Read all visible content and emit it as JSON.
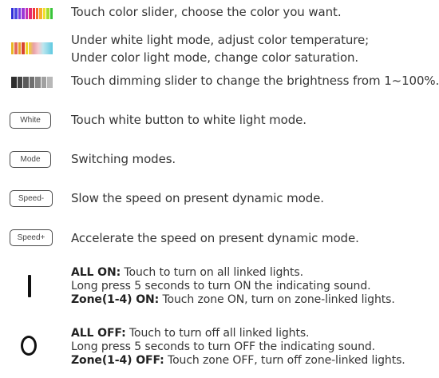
{
  "rows": [
    {
      "icon": "color-slider-icon",
      "text": "Touch color slider, choose the color you want."
    },
    {
      "icon": "saturation-slider-icon",
      "lines": [
        "Under white light mode, adjust color temperature;",
        "Under color light mode, change color saturation."
      ]
    },
    {
      "icon": "dimming-slider-icon",
      "text": "Touch dimming slider to change the brightness from 1~100%."
    },
    {
      "icon": "white-button-icon",
      "button": "White",
      "text": "Touch white button to white light mode."
    },
    {
      "icon": "mode-button-icon",
      "button": "Mode",
      "text": "Switching modes."
    },
    {
      "icon": "speed-minus-button-icon",
      "button": "Speed-",
      "text": "Slow the speed on present dynamic mode."
    },
    {
      "icon": "speed-plus-button-icon",
      "button": "Speed+",
      "text": "Accelerate the speed on present dynamic mode."
    },
    {
      "icon": "power-on-icon",
      "line1_bold": "ALL ON:",
      "line1": " Touch to turn on all linked lights.",
      "line2": "Long press 5 seconds to turn ON the indicating sound.",
      "line3_bold": "Zone(1-4) ON:",
      "line3": " Touch zone ON, turn on zone-linked lights."
    },
    {
      "icon": "power-off-icon",
      "line1_bold": "ALL OFF:",
      "line1": " Touch to turn off all linked lights.",
      "line2": "Long press 5 seconds to turn OFF the indicating sound.",
      "line3_bold": "Zone(1-4) OFF:",
      "line3": " Touch zone OFF, turn off zone-linked lights."
    }
  ],
  "colors": {
    "rainbow": [
      "#2d2bd8",
      "#4b48e0",
      "#7a3ee0",
      "#9c38d6",
      "#c22fb8",
      "#e42a6f",
      "#f2343a",
      "#f46a2a",
      "#f6b12a",
      "#f0e02a",
      "#a6dc2c",
      "#39c43a"
    ],
    "saturation": [
      "#f0d62a",
      "#e8a0a8",
      "#f5c9cf",
      "#bce6ee",
      "#8fd8e8",
      "#5cc8e0"
    ],
    "dimming": [
      "#2e2e2e",
      "#444444",
      "#5a5a5a",
      "#707070",
      "#888888",
      "#a0a0a0",
      "#b8b8b8"
    ]
  }
}
